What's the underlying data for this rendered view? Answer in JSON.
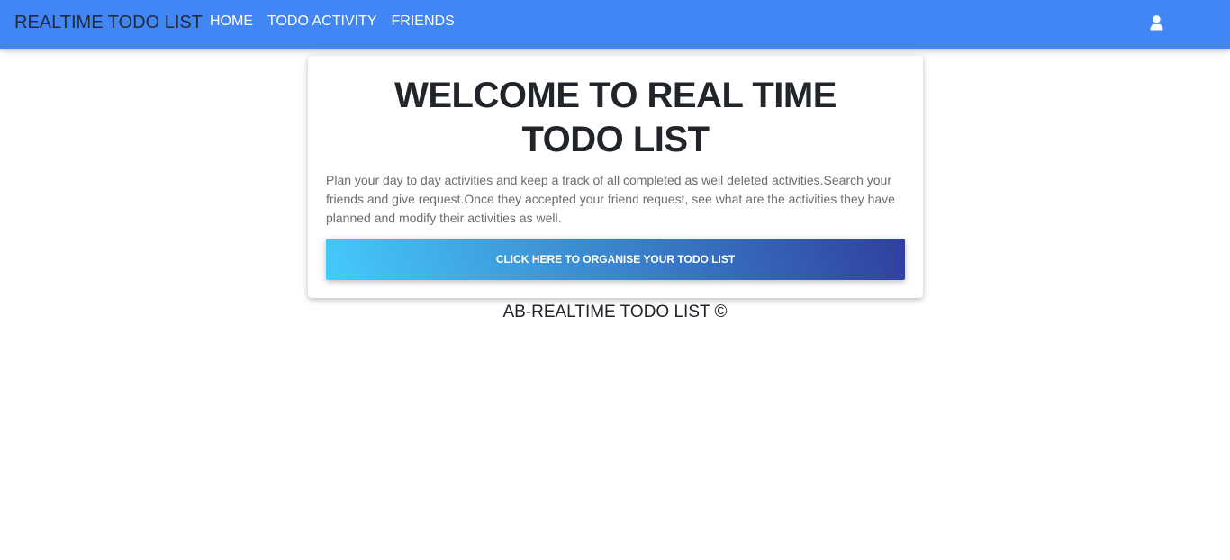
{
  "navbar": {
    "brand": "REALTIME TODO LIST",
    "links": [
      {
        "label": "HOME"
      },
      {
        "label": "TODO ACTIVITY"
      },
      {
        "label": "FRIENDS"
      }
    ],
    "user_icon": "user-icon",
    "background_color": "#4285f4"
  },
  "welcome_card": {
    "title": "WELCOME TO REAL TIME TODO LIST",
    "description": "Plan your day to day activities and keep a track of all completed as well deleted activities.Search your friends and give request.Once they accepted your friend request, see what are the activities they have planned and modify their activities as well.",
    "cta_label": "CLICK HERE TO ORGANISE YOUR TODO LIST",
    "cta_gradient": [
      "#45cafc",
      "#303f9f"
    ]
  },
  "footer": {
    "text": "AB-REALTIME TODO LIST ©"
  }
}
